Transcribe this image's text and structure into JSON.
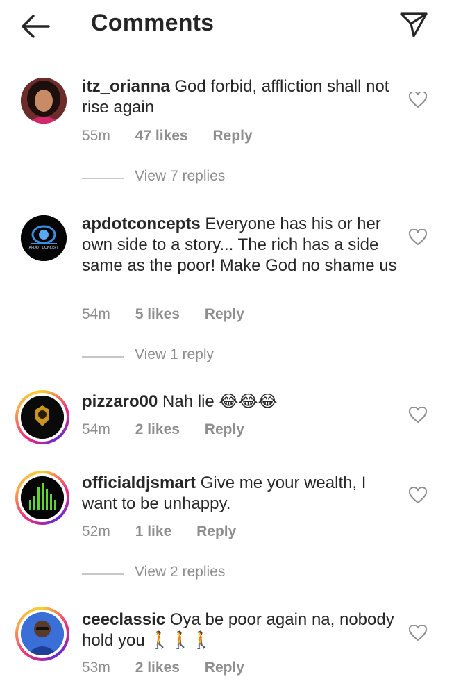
{
  "header": {
    "title": "Comments",
    "back_icon": "back-arrow-icon",
    "send_icon": "send-icon"
  },
  "comments": [
    {
      "username": "itz_orianna",
      "text": "God forbid, affliction shall not rise again",
      "time": "55m",
      "likes": "47 likes",
      "reply": "Reply",
      "view_replies": "View 7 replies"
    },
    {
      "username": "apdotconcepts",
      "text": "Everyone has his or her own side to a story... The rich has a side same as the poor! Make God no shame us",
      "time": "54m",
      "likes": "5 likes",
      "reply": "Reply",
      "view_replies": "View 1 reply",
      "avatar_text": "APDOT CONCEPT"
    },
    {
      "username": "pizzaro00",
      "text": "Nah lie 😂😂😂",
      "time": "54m",
      "likes": "2 likes",
      "reply": "Reply"
    },
    {
      "username": "officialdjsmart",
      "text": "Give me your wealth, I want to be unhappy.",
      "time": "52m",
      "likes": "1 like",
      "reply": "Reply",
      "view_replies": "View 2 replies"
    },
    {
      "username": "ceeclassic",
      "text": "Oya be poor again na, nobody hold you 🚶🚶🚶",
      "time": "53m",
      "likes": "2 likes",
      "reply": "Reply"
    }
  ],
  "colors": {
    "text": "#262626",
    "muted": "#8e8e8e",
    "divider": "#c7c7c7"
  }
}
